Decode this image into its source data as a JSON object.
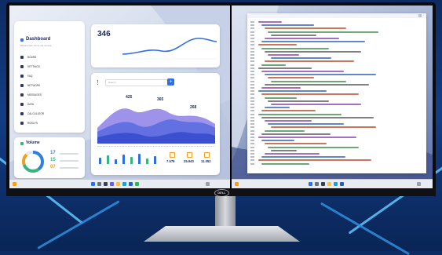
{
  "dashboard": {
    "title": "Dashboard",
    "subtitle": "Welcome back, here is your overview",
    "nav": [
      {
        "label": "BOARD",
        "icon": "grid-icon"
      },
      {
        "label": "SETTINGS",
        "icon": "gear-icon"
      },
      {
        "label": "FAQ",
        "icon": "help-icon"
      },
      {
        "label": "NETWORK",
        "icon": "share-icon"
      },
      {
        "label": "MESSAGES",
        "icon": "mail-icon"
      },
      {
        "label": "DATA",
        "icon": "chart-icon"
      },
      {
        "label": "CALCULATOR",
        "icon": "calc-icon"
      },
      {
        "label": "ROSLYN",
        "icon": "circle-icon"
      }
    ],
    "stat_value": "346",
    "search_placeholder": "Search",
    "add_label": "+",
    "wave_values": [
      "425",
      "365",
      "268"
    ],
    "volume": {
      "title": "Volume",
      "items": [
        {
          "value": "17",
          "color": "#2f7fe0"
        },
        {
          "value": "15",
          "color": "#36b37e"
        },
        {
          "value": "07",
          "color": "#f0a020"
        }
      ]
    },
    "totals": [
      "7.578",
      "25.940",
      "11.052"
    ],
    "accent": "#2f6fe0"
  },
  "monitor": {
    "brand": "DELL"
  }
}
